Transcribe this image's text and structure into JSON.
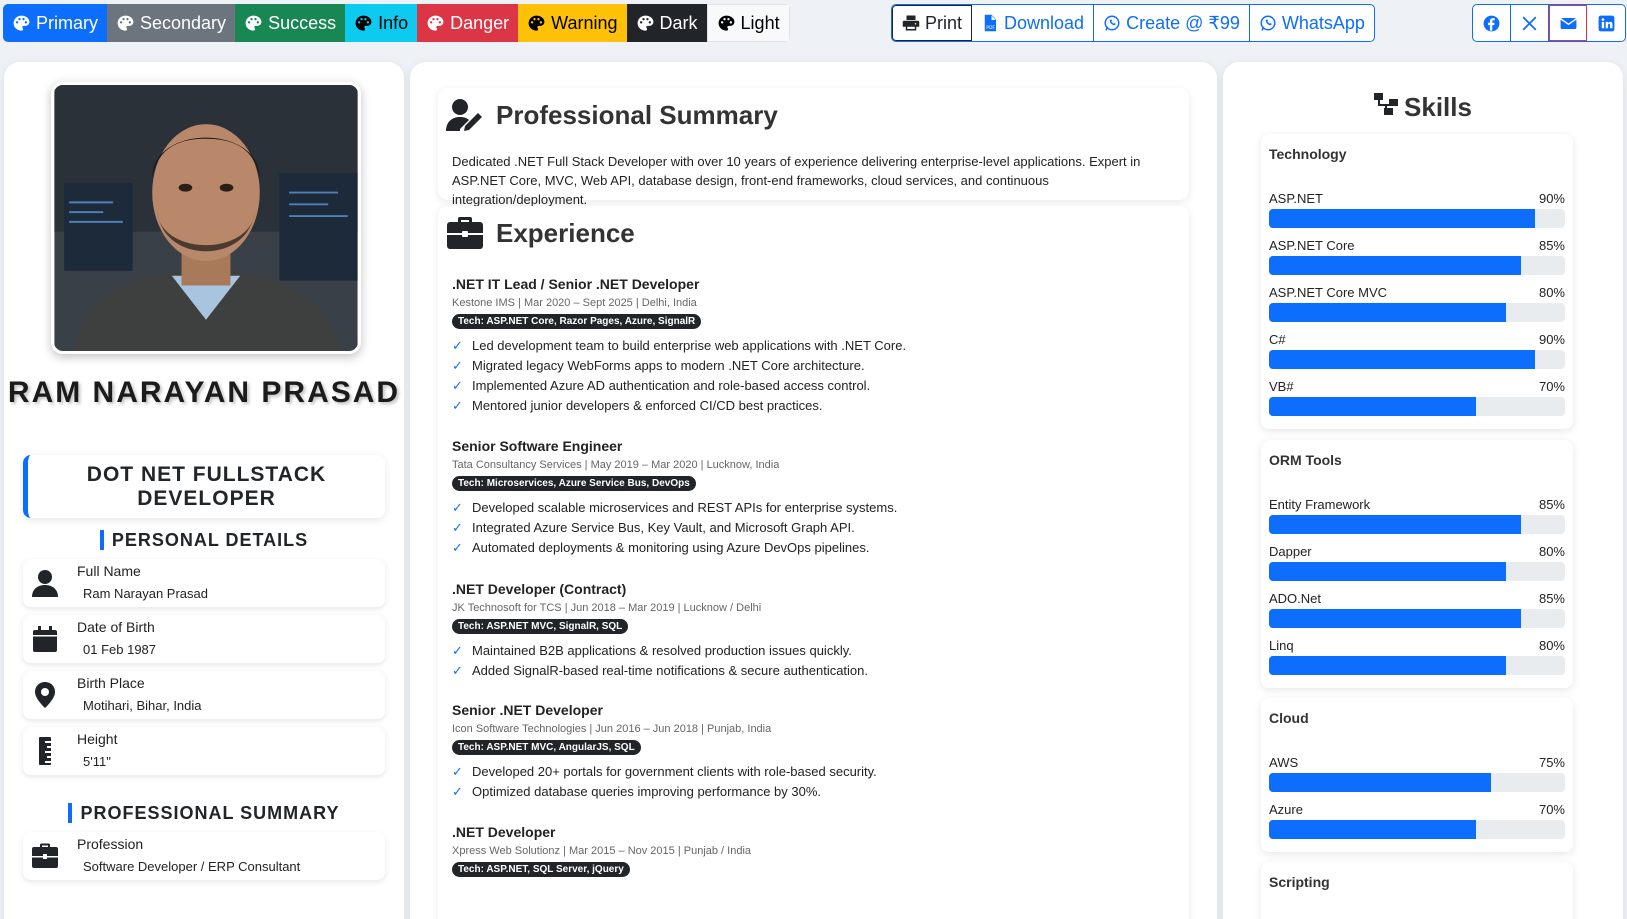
{
  "toolbar": {
    "themes": [
      {
        "label": "Primary",
        "bg": "#0d6efd",
        "fg": "#ffffff"
      },
      {
        "label": "Secondary",
        "bg": "#6c757d",
        "fg": "#ffffff"
      },
      {
        "label": "Success",
        "bg": "#198754",
        "fg": "#ffffff"
      },
      {
        "label": "Info",
        "bg": "#0dcaf0",
        "fg": "#000000"
      },
      {
        "label": "Danger",
        "bg": "#dc3545",
        "fg": "#ffffff"
      },
      {
        "label": "Warning",
        "bg": "#ffc107",
        "fg": "#000000"
      },
      {
        "label": "Dark",
        "bg": "#212529",
        "fg": "#ffffff"
      },
      {
        "label": "Light",
        "bg": "#f8f9fa",
        "fg": "#000000"
      }
    ],
    "actions": {
      "print": "Print",
      "download": "Download",
      "create": "Create @ ₹99",
      "whatsapp": "WhatsApp"
    },
    "share_icons": [
      "facebook-icon",
      "x-icon",
      "mail-icon",
      "linkedin-icon"
    ]
  },
  "profile": {
    "name": "RAM NARAYAN PRASAD",
    "role": "DOT NET FULLSTACK DEVELOPER",
    "personal_heading": "PERSONAL DETAILS",
    "personal": [
      {
        "label": "Full Name",
        "value": "Ram Narayan Prasad",
        "icon": "user-icon"
      },
      {
        "label": "Date of Birth",
        "value": "01 Feb 1987",
        "icon": "calendar-icon"
      },
      {
        "label": "Birth Place",
        "value": "Motihari, Bihar, India",
        "icon": "location-icon"
      },
      {
        "label": "Height",
        "value": "5'11\"",
        "icon": "ruler-icon"
      }
    ],
    "professional_heading": "PROFESSIONAL SUMMARY",
    "professional": [
      {
        "label": "Profession",
        "value": "Software Developer / ERP Consultant",
        "icon": "briefcase-icon"
      }
    ]
  },
  "summary": {
    "title": "Professional Summary",
    "text": "Dedicated .NET Full Stack Developer with over 10 years of experience delivering enterprise-level applications. Expert in ASP.NET Core, MVC, Web API, database design, front-end frameworks, cloud services, and continuous integration/deployment."
  },
  "experience": {
    "title": "Experience",
    "jobs": [
      {
        "title": ".NET IT Lead / Senior .NET Developer",
        "meta": "Kestone IMS | Mar 2020 – Sept 2025 | Delhi, India",
        "tech": "Tech: ASP.NET Core, Razor Pages, Azure, SignalR",
        "points": [
          "Led development team to build enterprise web applications with .NET Core.",
          "Migrated legacy WebForms apps to modern .NET Core architecture.",
          "Implemented Azure AD authentication and role-based access control.",
          "Mentored junior developers & enforced CI/CD best practices."
        ]
      },
      {
        "title": "Senior Software Engineer",
        "meta": "Tata Consultancy Services | May 2019 – Mar 2020 | Lucknow, India",
        "tech": "Tech: Microservices, Azure Service Bus, DevOps",
        "points": [
          "Developed scalable microservices and REST APIs for enterprise systems.",
          "Integrated Azure Service Bus, Key Vault, and Microsoft Graph API.",
          "Automated deployments & monitoring using Azure DevOps pipelines."
        ]
      },
      {
        "title": ".NET Developer (Contract)",
        "meta": "JK Technosoft for TCS | Jun 2018 – Mar 2019 | Lucknow / Delhi",
        "tech": "Tech: ASP.NET MVC, SignalR, SQL",
        "points": [
          "Maintained B2B applications & resolved production issues quickly.",
          "Added SignalR-based real-time notifications & secure authentication."
        ]
      },
      {
        "title": "Senior .NET Developer",
        "meta": "Icon Software Technologies | Jun 2016 – Jun 2018 | Punjab, India",
        "tech": "Tech: ASP.NET MVC, AngularJS, SQL",
        "points": [
          "Developed 20+ portals for government clients with role-based security.",
          "Optimized database queries improving performance by 30%."
        ]
      },
      {
        "title": ".NET Developer",
        "meta": "Xpress Web Solutionz | Mar 2015 – Nov 2015 | Punjab / India",
        "tech": "Tech: ASP.NET, SQL Server, jQuery",
        "points": []
      }
    ]
  },
  "skills": {
    "title": "Skills",
    "groups": [
      {
        "name": "Technology",
        "items": [
          {
            "name": "ASP.NET",
            "pct": "90%",
            "value": 90
          },
          {
            "name": "ASP.NET Core",
            "pct": "85%",
            "value": 85
          },
          {
            "name": "ASP.NET Core MVC",
            "pct": "80%",
            "value": 80
          },
          {
            "name": "C#",
            "pct": "90%",
            "value": 90
          },
          {
            "name": "VB#",
            "pct": "70%",
            "value": 70
          }
        ]
      },
      {
        "name": "ORM Tools",
        "items": [
          {
            "name": "Entity Framework",
            "pct": "85%",
            "value": 85
          },
          {
            "name": "Dapper",
            "pct": "80%",
            "value": 80
          },
          {
            "name": "ADO.Net",
            "pct": "85%",
            "value": 85
          },
          {
            "name": "Linq",
            "pct": "80%",
            "value": 80
          }
        ]
      },
      {
        "name": "Cloud",
        "items": [
          {
            "name": "AWS",
            "pct": "75%",
            "value": 75
          },
          {
            "name": "Azure",
            "pct": "70%",
            "value": 70
          }
        ]
      },
      {
        "name": "Scripting",
        "items": []
      }
    ]
  }
}
